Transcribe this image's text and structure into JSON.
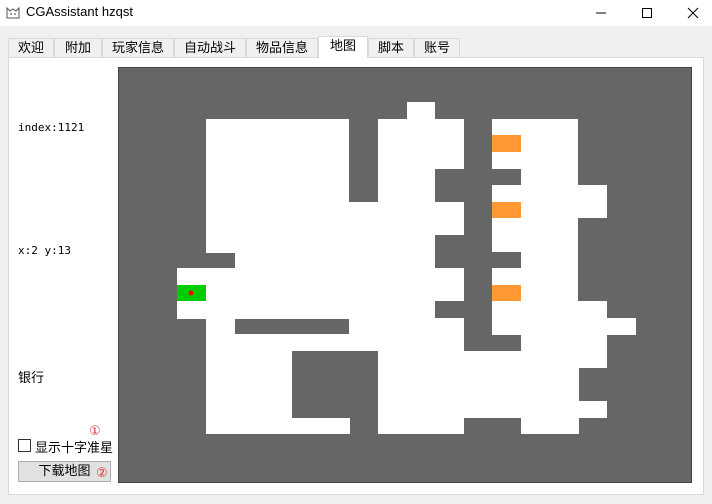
{
  "window": {
    "title": "CGAssistant hzqst",
    "icon": "cat-face-icon"
  },
  "tabs": [
    {
      "label": "欢迎",
      "active": false
    },
    {
      "label": "附加",
      "active": false
    },
    {
      "label": "玩家信息",
      "active": false
    },
    {
      "label": "自动战斗",
      "active": false
    },
    {
      "label": "物品信息",
      "active": false
    },
    {
      "label": "地图",
      "active": true
    },
    {
      "label": "脚本",
      "active": false
    },
    {
      "label": "账号",
      "active": false
    }
  ],
  "map_panel": {
    "index_text": "index:1121",
    "coords_text": "x:2 y:13",
    "location_name": "银行",
    "crosshair_checkbox": {
      "label": "显示十字准星",
      "checked": false
    },
    "download_button_label": "下载地图",
    "marker_1": "①",
    "marker_2": "②"
  },
  "colors": {
    "wall": "#666666",
    "floor": "#ffffff",
    "npc": "#ff9933",
    "player": "#00cc00",
    "player_dot": "#ff0000"
  }
}
